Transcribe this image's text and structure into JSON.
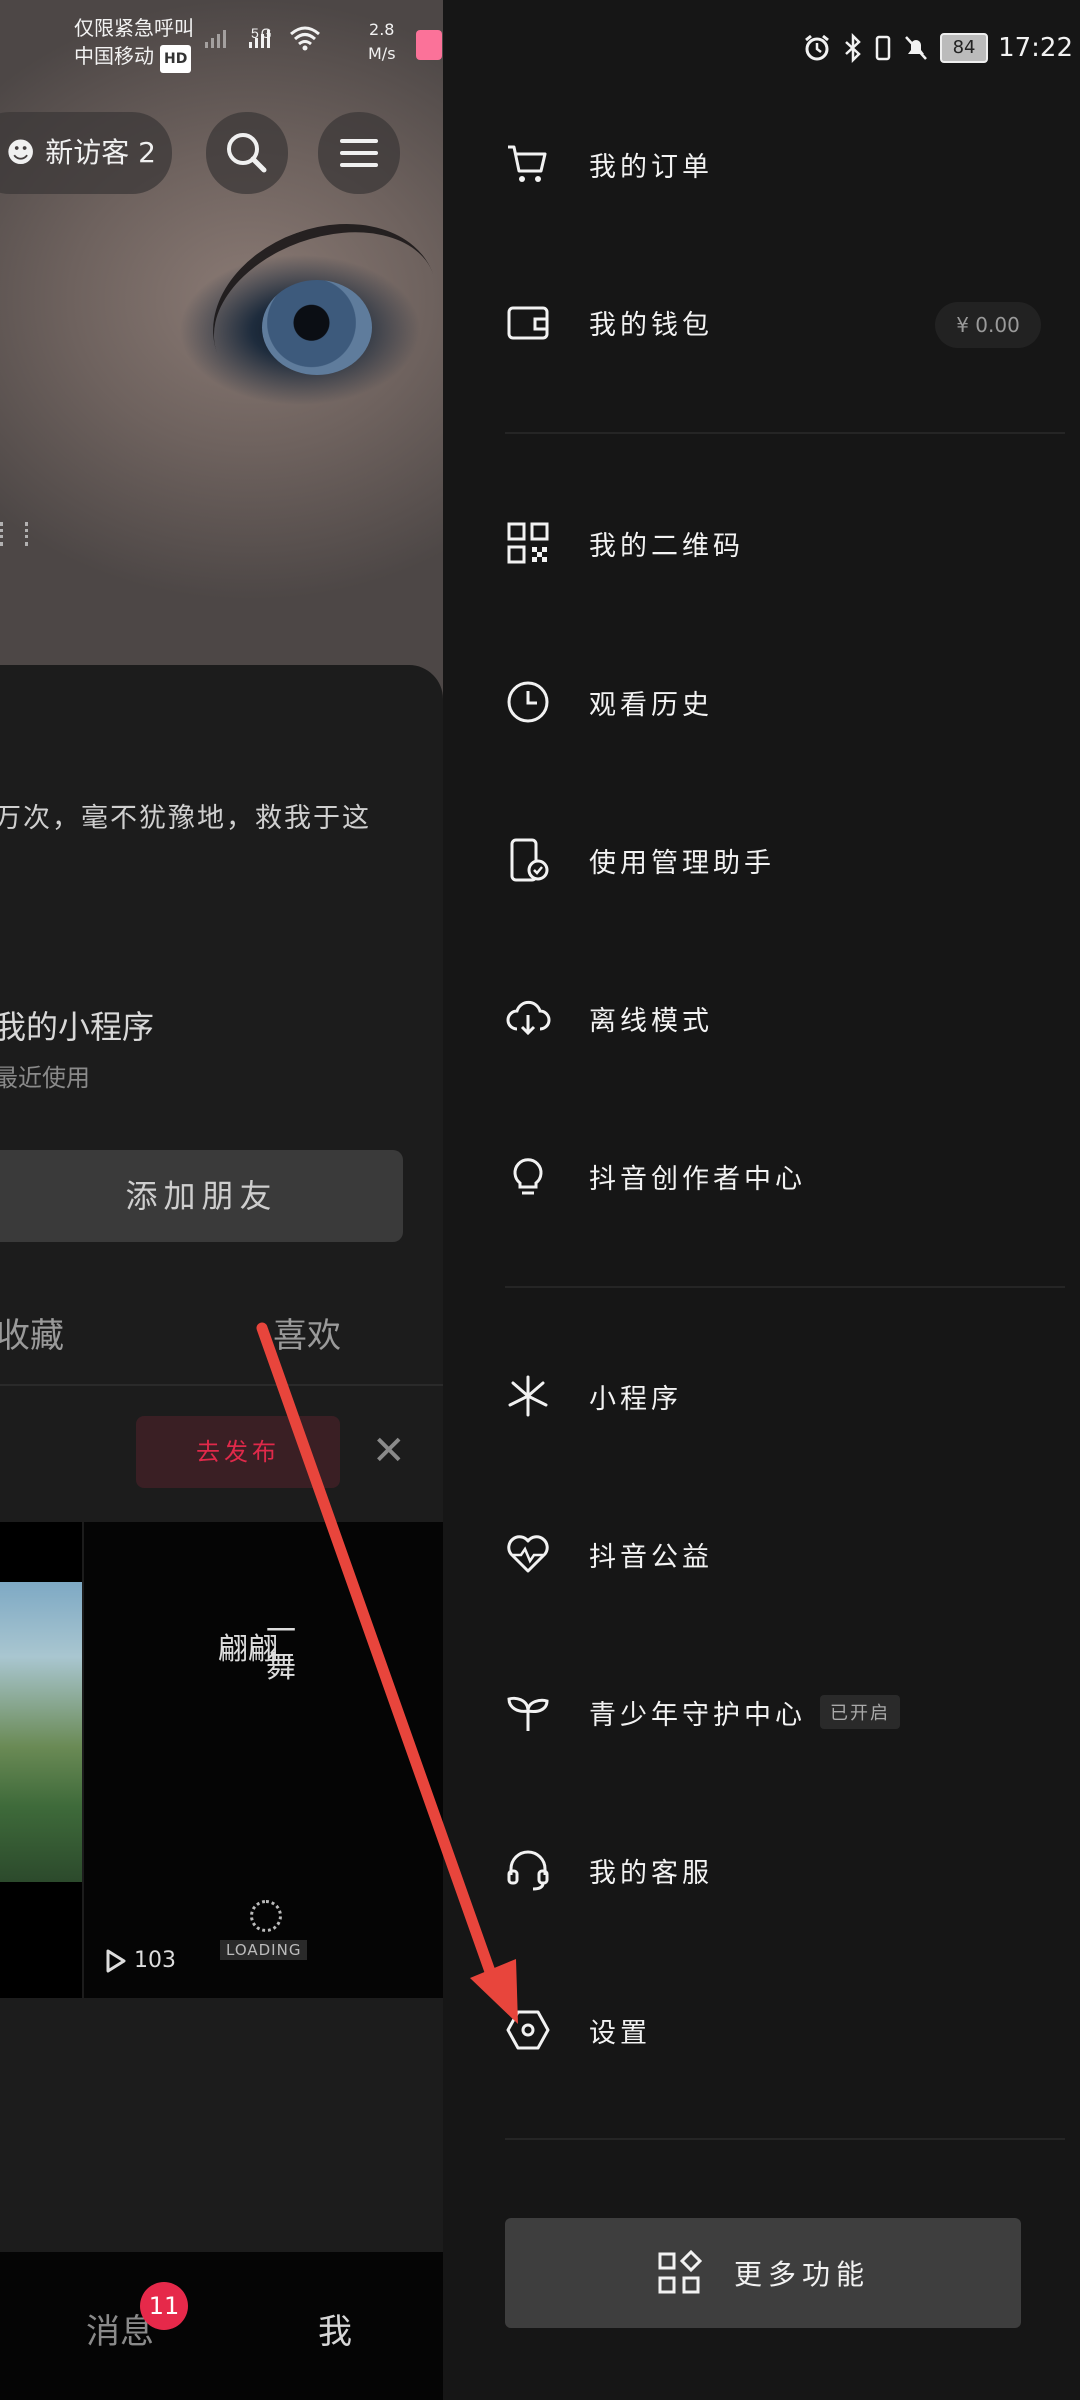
{
  "status_bar": {
    "carrier_line1": "仅限紧急呼叫",
    "carrier_line2": "中国移动",
    "hd": "HD",
    "network": "5G",
    "speed_value": "2.8",
    "speed_unit": "M/s",
    "battery": "84",
    "time": "17:22"
  },
  "profile": {
    "visitor_label": "新访客",
    "visitor_count": "2",
    "bio": "万次，毫不犹豫地，救我于这",
    "mini_program_title": "我的小程序",
    "mini_program_sub": "最近使用",
    "add_friend": "添加朋友",
    "tabs": [
      "收藏",
      "喜欢"
    ],
    "publish_button": "去发布",
    "video_calligraphy_a": "翩翩",
    "video_calligraphy_b": "一舞",
    "video_loading": "LOADING",
    "video_plays": "103"
  },
  "bottom_nav": {
    "messages": "消息",
    "messages_badge": "11",
    "me": "我"
  },
  "drawer": {
    "items": [
      {
        "label": "我的订单",
        "icon": "cart-icon"
      },
      {
        "label": "我的钱包",
        "icon": "wallet-icon",
        "value": "¥ 0.00"
      },
      {
        "label": "我的二维码",
        "icon": "qr-code-icon"
      },
      {
        "label": "观看历史",
        "icon": "clock-icon"
      },
      {
        "label": "使用管理助手",
        "icon": "phone-check-icon"
      },
      {
        "label": "离线模式",
        "icon": "cloud-download-icon"
      },
      {
        "label": "抖音创作者中心",
        "icon": "lightbulb-icon"
      },
      {
        "label": "小程序",
        "icon": "mini-program-icon"
      },
      {
        "label": "抖音公益",
        "icon": "heart-pulse-icon"
      },
      {
        "label": "青少年守护中心",
        "icon": "sprout-icon",
        "tag": "已开启"
      },
      {
        "label": "我的客服",
        "icon": "headset-icon"
      },
      {
        "label": "设置",
        "icon": "settings-hexagon-icon"
      }
    ],
    "more_button": "更多功能"
  },
  "colors": {
    "drawer_bg": "#161616",
    "accent_red": "#e6294a",
    "annotation_arrow": "#e8453c"
  }
}
